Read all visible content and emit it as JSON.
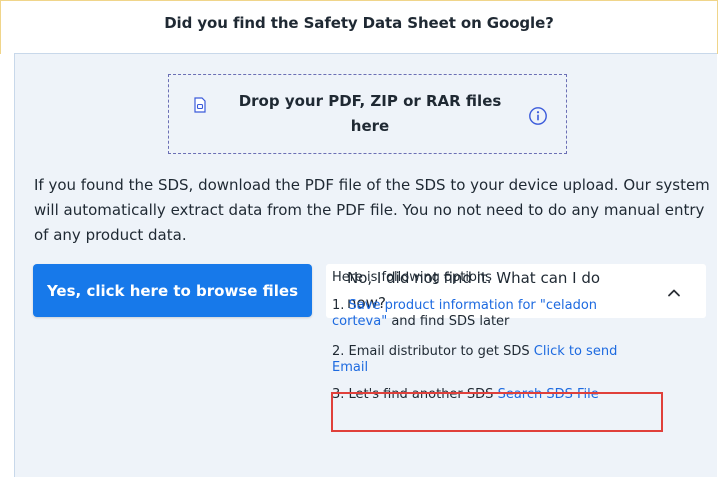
{
  "header": {
    "title": "Did you find the Safety Data Sheet on Google?"
  },
  "dropzone": {
    "text": "Drop your PDF, ZIP or RAR files here",
    "file_icon": "file-icon",
    "info_icon": "info-circle-icon"
  },
  "help_text": "If you found the SDS, download the PDF file of the SDS to your device upload. Our system will automatically extract data from the PDF file. You no not need to do any manual entry of any product data.",
  "browse_button": {
    "label": "Yes, click here to browse files"
  },
  "accordion": {
    "label": "No, I did not find it. What can I do now?",
    "expanded": true,
    "chevron_icon": "chevron-up-icon"
  },
  "options": {
    "heading": "Here is following options",
    "items": [
      {
        "prefix": "1. ",
        "link": "Save product information for \"celadon corteva\"",
        "suffix": " and find SDS later"
      },
      {
        "prefix": "2. Email distributor to get SDS ",
        "link": "Click to send Email",
        "suffix": ""
      },
      {
        "prefix": "3. Let's find another SDS ",
        "link": "Search SDS File",
        "suffix": ""
      }
    ]
  },
  "colors": {
    "primary_button": "#1779ea",
    "link": "#1d6ae0",
    "highlight_border": "#e0403b",
    "panel_background": "#eef3f9",
    "dropzone_border": "#6b6fb5"
  }
}
